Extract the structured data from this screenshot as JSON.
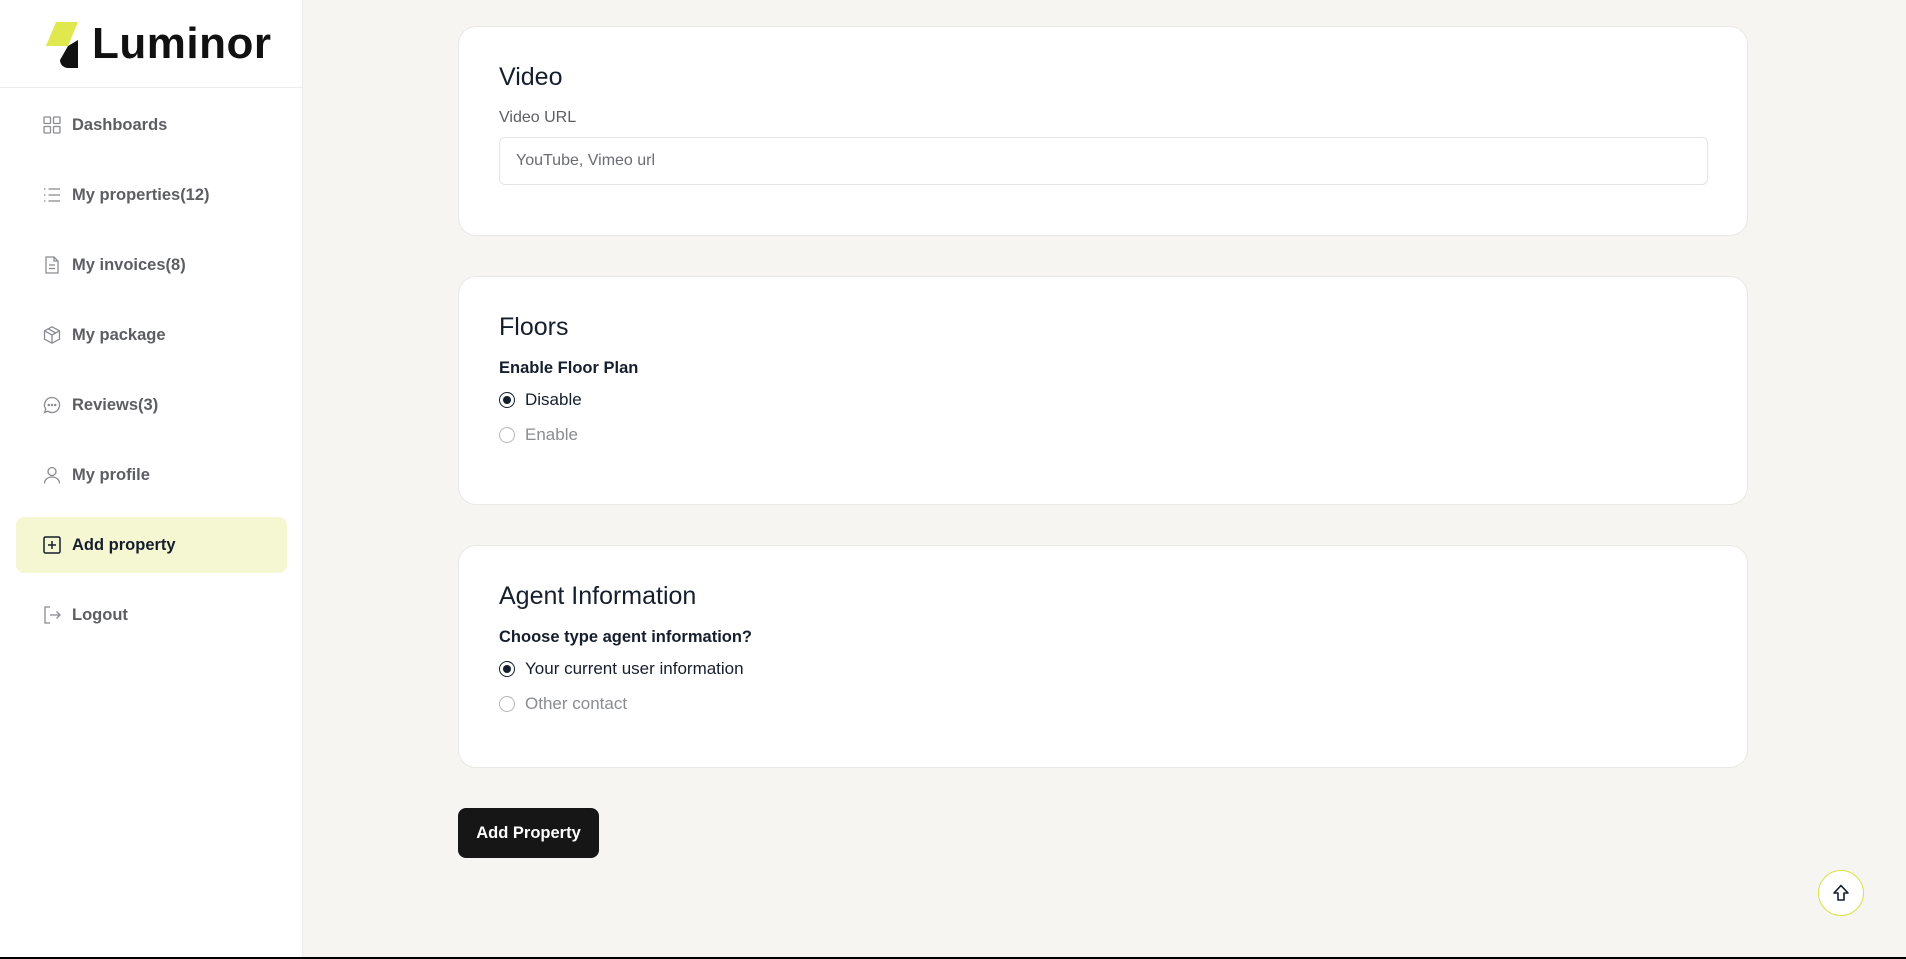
{
  "brand": {
    "name": "Luminor",
    "accent": "#dfe84d",
    "active_bg": "#f5f7d2"
  },
  "sidebar": {
    "items": [
      {
        "label": "Dashboards",
        "icon": "grid-icon"
      },
      {
        "label": "My properties(12)",
        "icon": "list-icon"
      },
      {
        "label": "My invoices(8)",
        "icon": "document-icon"
      },
      {
        "label": "My package",
        "icon": "package-icon"
      },
      {
        "label": "Reviews(3)",
        "icon": "chat-icon"
      },
      {
        "label": "My profile",
        "icon": "user-icon"
      },
      {
        "label": "Add property",
        "icon": "plus-square-icon",
        "active": true
      },
      {
        "label": "Logout",
        "icon": "logout-icon"
      }
    ]
  },
  "video": {
    "title": "Video",
    "url_label": "Video URL",
    "url_placeholder": "YouTube, Vimeo url",
    "url_value": ""
  },
  "floors": {
    "title": "Floors",
    "group_label": "Enable Floor Plan",
    "options": [
      "Disable",
      "Enable"
    ],
    "selected": "Disable"
  },
  "agent": {
    "title": "Agent Information",
    "group_label": "Choose type agent information?",
    "options": [
      "Your current user information",
      "Other contact"
    ],
    "selected": "Your current user information"
  },
  "actions": {
    "submit_label": "Add Property",
    "scroll_top_icon": "arrow-up-icon"
  }
}
